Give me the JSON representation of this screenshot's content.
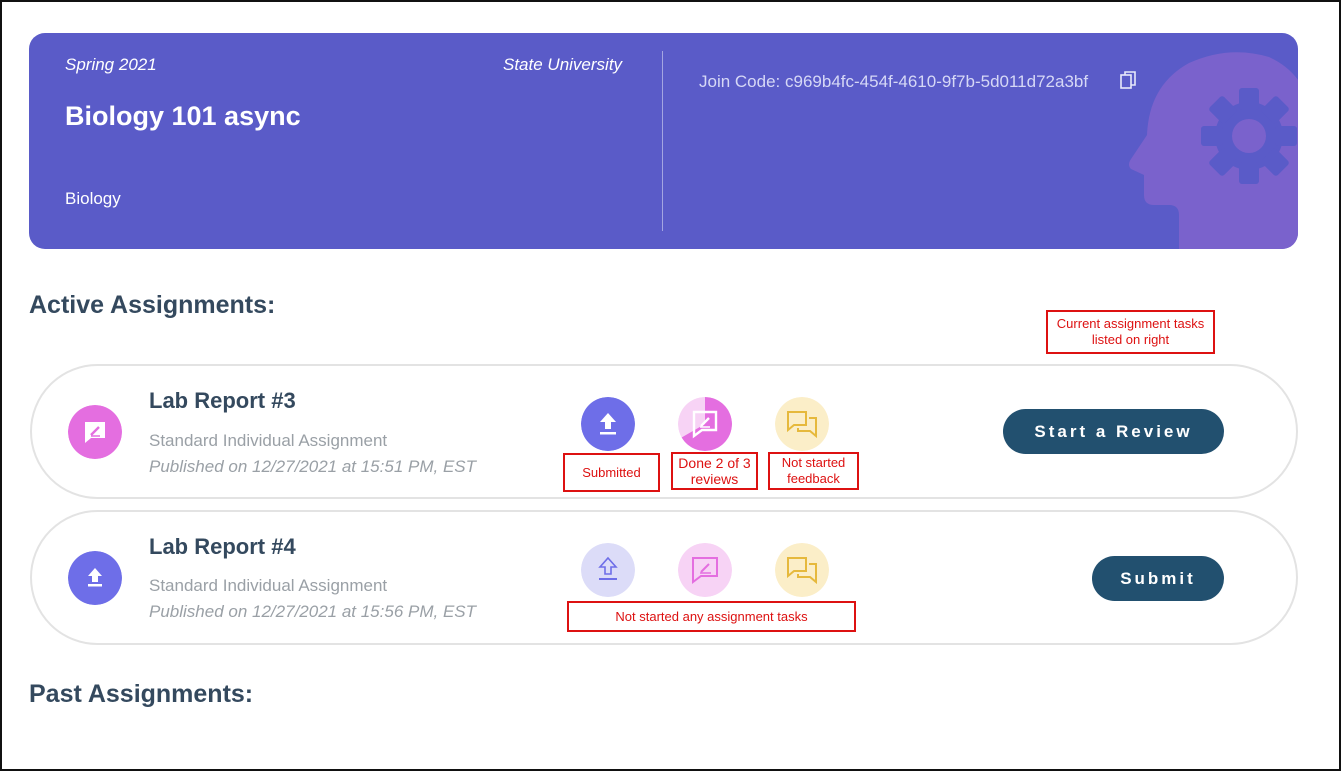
{
  "course": {
    "term": "Spring 2021",
    "school": "State University",
    "title": "Biology 101 async",
    "subject": "Biology",
    "join_code": "Join Code: c969b4fc-454f-4610-9f7b-5d011d72a3bf"
  },
  "sections": {
    "active": "Active Assignments:",
    "past": "Past Assignments:"
  },
  "assignments": [
    {
      "title": "Lab Report #3",
      "type": "Standard Individual Assignment",
      "published": "Published on 12/27/2021 at 15:51 PM, EST",
      "action": "Start a Review",
      "tasks": {
        "submit": "done",
        "review_progress": 0.667,
        "feedback": "not-started"
      }
    },
    {
      "title": "Lab Report #4",
      "type": "Standard Individual Assignment",
      "published": "Published on 12/27/2021 at 15:56 PM, EST",
      "action": "Submit",
      "tasks": {
        "submit": "not-started",
        "review_progress": 0,
        "feedback": "not-started"
      }
    }
  ],
  "annotations": {
    "current_tasks": "Current assignment tasks listed on right",
    "submitted": "Submitted",
    "done_reviews": "Done 2 of 3 reviews",
    "not_started_feedback": "Not started feedback",
    "not_started_any": "Not started any assignment tasks"
  },
  "colors": {
    "course_card": "#5a5bc8",
    "head_art": "#7a62cc",
    "submit_task": "#6e6ee8",
    "review_task": "#e46ee0",
    "feedback_task": "#fbeec8",
    "button": "#22506f",
    "annotation": "#dd1111"
  }
}
